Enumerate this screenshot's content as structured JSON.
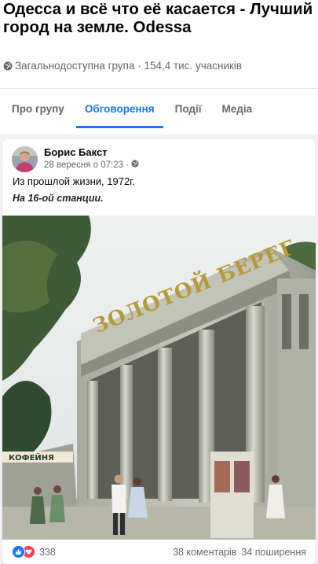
{
  "group": {
    "title": "Одесса и всё что её касается - Лучший город на земле. Odessa",
    "meta": "Загальнодоступна група · 154,4 тис. учасників"
  },
  "tabs": [
    {
      "label": "Про групу",
      "active": false
    },
    {
      "label": "Обговорення",
      "active": true
    },
    {
      "label": "Події",
      "active": false
    },
    {
      "label": "Медіа",
      "active": false
    }
  ],
  "post": {
    "author": "Борис Бакст",
    "time": "28 вересня о 07:23 ·",
    "text": "Из прошлой жизни, 1972г.",
    "subtext": "На 16-ой станции.",
    "photo_sign_top": "ЗОЛОТОЙ БЕРЕГ",
    "photo_sign_left": "КОФЕЙНЯ"
  },
  "footer": {
    "reactions_count": "338",
    "comments": "38 коментарів",
    "shares": "34 поширення"
  },
  "colors": {
    "accent": "#1877f2",
    "secondary_text": "#65676b",
    "background": "#f0f2f5",
    "love": "#f33e58"
  }
}
